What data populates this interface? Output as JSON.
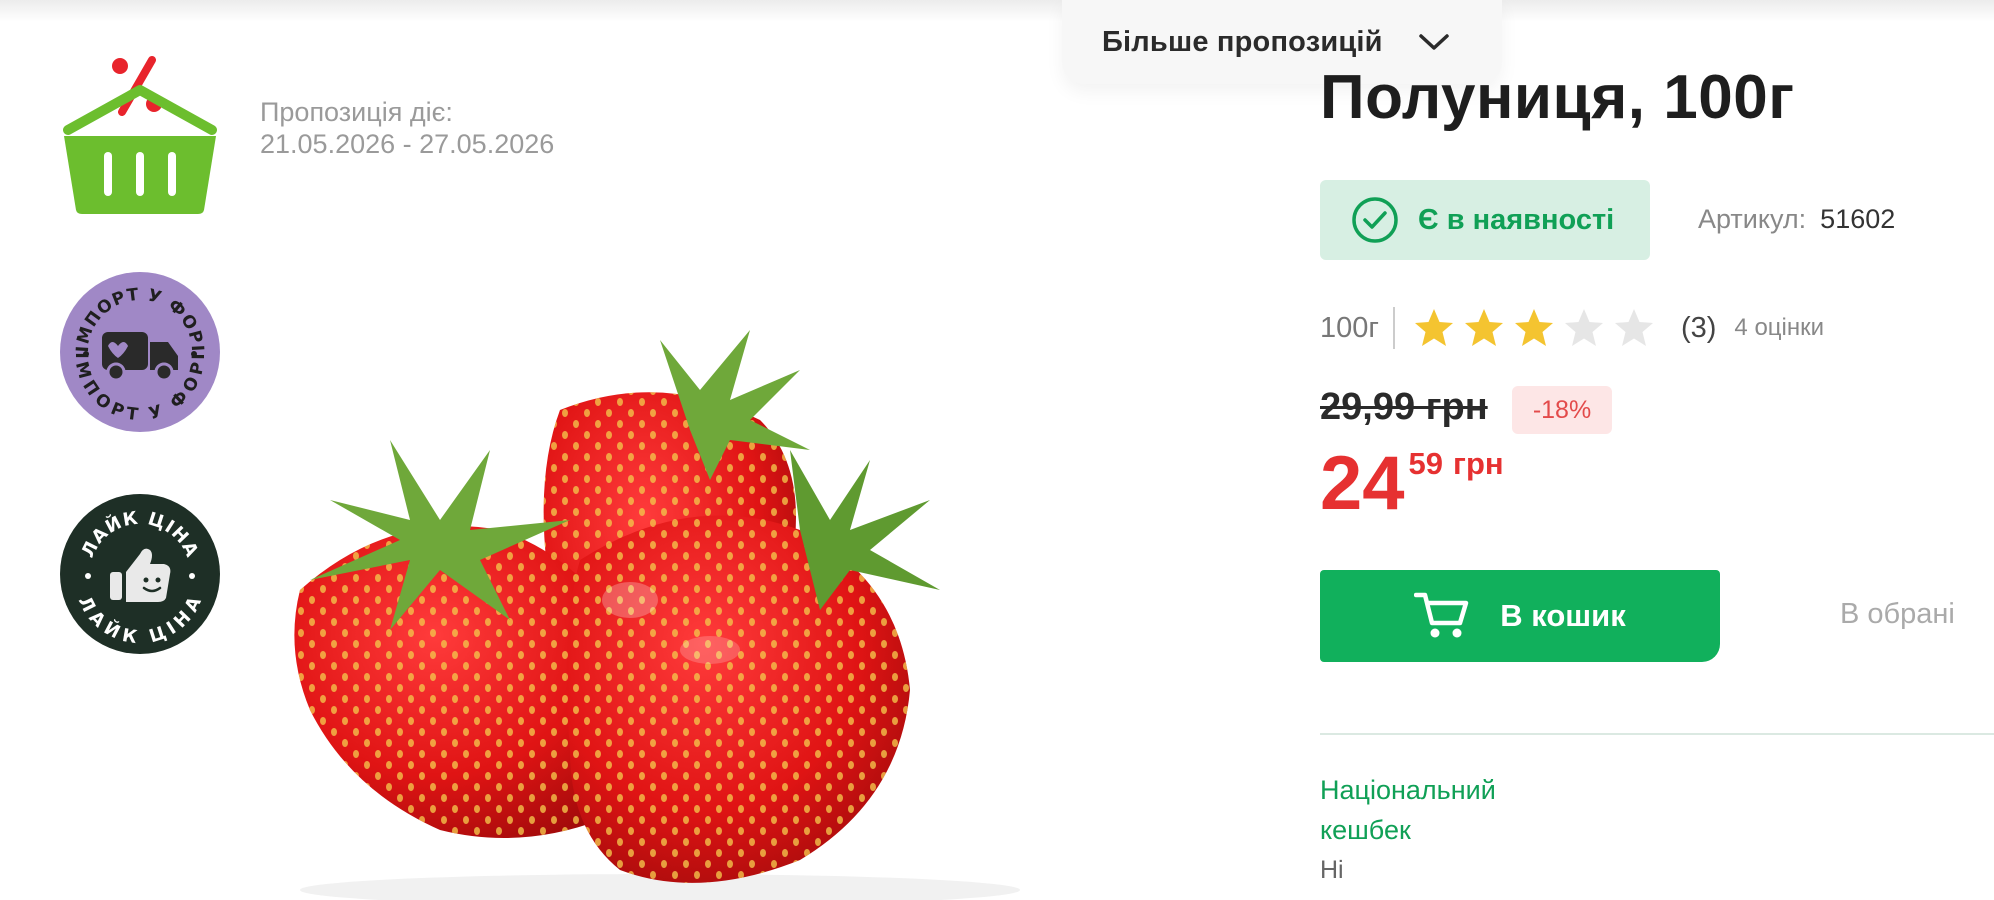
{
  "header": {
    "more_offers_label": "Більше пропозицій"
  },
  "badges": {
    "import_text": "ІМПОРТ У ФОРІ",
    "like_text": "ЛАЙК ЦІНА"
  },
  "offer": {
    "label": "Пропозиція діє:",
    "dates": "21.05.2026 - 27.05.2026"
  },
  "product": {
    "title": "Полуниця, 100г",
    "availability": "Є в наявності",
    "sku_label": "Артикул:",
    "sku_value": "51602",
    "weight": "100г",
    "rating": 3,
    "rating_max": 5,
    "rating_count": "(3)",
    "reviews_label": "4 оцінки",
    "old_price": "29,99 грн",
    "discount": "-18%",
    "price_int": "24",
    "price_cents": "59",
    "currency": "грн",
    "add_to_cart": "В кошик",
    "wishlist": "В обрані",
    "cashback_label": "Національний кешбек",
    "cashback_value": "Ні"
  },
  "colors": {
    "brand_green": "#11b05c",
    "price_red": "#e63131",
    "star_filled": "#f4c430",
    "star_empty": "#e6e6e6",
    "badge_purple": "#a088c6",
    "badge_dark": "#1e2f26",
    "basket_green": "#6cbe2e",
    "percent_red": "#e8242c"
  },
  "icons": [
    "chevron-down-icon",
    "sale-basket-icon",
    "import-truck-icon",
    "like-thumb-icon",
    "check-circle-icon",
    "star-icon",
    "cart-icon"
  ]
}
